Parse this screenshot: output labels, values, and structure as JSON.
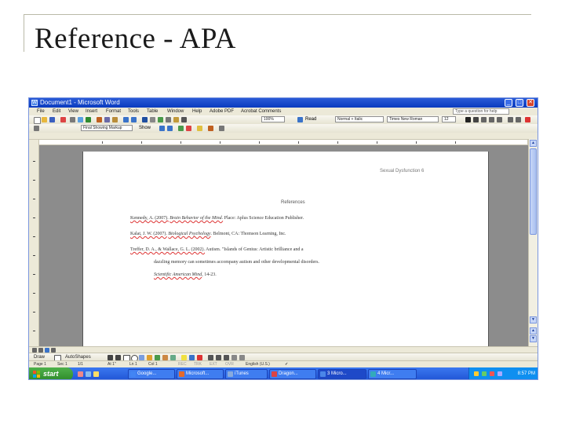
{
  "slide": {
    "title": "Reference - APA"
  },
  "window": {
    "title": "Document1 - Microsoft Word",
    "controls": {
      "minimize": "_",
      "maximize": "□",
      "close": "✕"
    }
  },
  "menu": {
    "items": [
      "File",
      "Edit",
      "View",
      "Insert",
      "Format",
      "Tools",
      "Table",
      "Window",
      "Help",
      "Adobe PDF",
      "Acrobat Comments"
    ],
    "help_placeholder": "Type a question for help"
  },
  "toolbar": {
    "zoom": "100%",
    "read_label": "Read",
    "style": "Normal + Italic",
    "font": "Times New Roman",
    "font_size": "12",
    "style2": "Final Showing Markup",
    "show_label": "Show"
  },
  "document": {
    "running_head": "Sexual Dysfunction 6",
    "heading": "References",
    "references": [
      {
        "author": "Kennedy, A. (2007).",
        "title": "Brain Behavior of the Mind.",
        "rest": "Place: Aplus Science Education Publisher."
      },
      {
        "author": "Kalat, J. W. (2007).",
        "title": "Biological Psychology",
        "rest": ". Belmont, CA: Thomson Learning, Inc."
      },
      {
        "author": "Treffer, D. A., & Wallace, G. L. (2002).",
        "title": "",
        "rest": " Autism. \"Islands of Genius: Artistic brilliance and a"
      },
      {
        "author": "",
        "title": "",
        "rest": "dazzling memory can sometimes accompany autism and other developmental disorders."
      },
      {
        "author": "",
        "title": "Scientific American Mind",
        "rest": ", 14-23."
      }
    ]
  },
  "drawing": {
    "draw_label": "Draw",
    "autoshapes_label": "AutoShapes"
  },
  "status": {
    "page": "Page 1",
    "sec": "Sec 1",
    "page_of": "1/1",
    "at": "At 1\"",
    "ln": "Ln 1",
    "col": "Col 1",
    "modes": [
      "REC",
      "TRK",
      "EXT",
      "OVR"
    ],
    "language": "English (U.S.)"
  },
  "taskbar": {
    "start_label": "start",
    "items": [
      "Google...",
      "Microsoft...",
      "iTunes",
      "Dragon...",
      "3 Micro...",
      "4 Micr..."
    ],
    "clock": "8:57 PM"
  }
}
